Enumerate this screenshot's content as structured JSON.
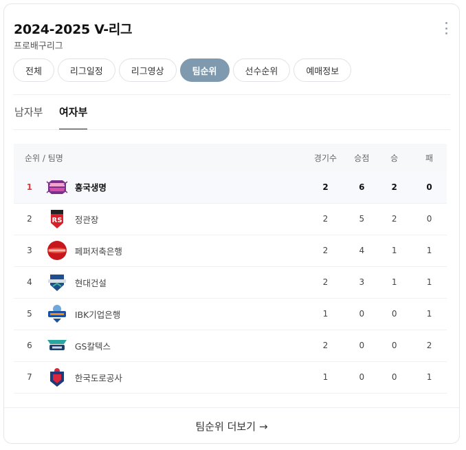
{
  "header": {
    "title": "2024-2025 V-리그",
    "subtitle": "프로배구리그"
  },
  "tabs": [
    {
      "label": "전체",
      "active": false
    },
    {
      "label": "리그일정",
      "active": false
    },
    {
      "label": "리그영상",
      "active": false
    },
    {
      "label": "팀순위",
      "active": true
    },
    {
      "label": "선수순위",
      "active": false
    },
    {
      "label": "예매정보",
      "active": false
    }
  ],
  "subtabs": [
    {
      "label": "남자부",
      "active": false
    },
    {
      "label": "여자부",
      "active": true
    }
  ],
  "table": {
    "headers": {
      "team": "순위 / 팀명",
      "games": "경기수",
      "points": "승점",
      "wins": "승",
      "losses": "패"
    },
    "rows": [
      {
        "rank": "1",
        "team": "흥국생명",
        "games": "2",
        "points": "6",
        "wins": "2",
        "losses": "0",
        "logo": "pinkspiders-logo-icon"
      },
      {
        "rank": "2",
        "team": "정관장",
        "games": "2",
        "points": "5",
        "wins": "2",
        "losses": "0",
        "logo": "redsparks-logo-icon"
      },
      {
        "rank": "3",
        "team": "페퍼저축은행",
        "games": "2",
        "points": "4",
        "wins": "1",
        "losses": "1",
        "logo": "aipeppers-logo-icon"
      },
      {
        "rank": "4",
        "team": "현대건설",
        "games": "2",
        "points": "3",
        "wins": "1",
        "losses": "1",
        "logo": "hillstate-logo-icon"
      },
      {
        "rank": "5",
        "team": "IBK기업은행",
        "games": "1",
        "points": "0",
        "wins": "0",
        "losses": "1",
        "logo": "altos-logo-icon"
      },
      {
        "rank": "6",
        "team": "GS칼텍스",
        "games": "2",
        "points": "0",
        "wins": "0",
        "losses": "2",
        "logo": "kixx-logo-icon"
      },
      {
        "rank": "7",
        "team": "한국도로공사",
        "games": "1",
        "points": "0",
        "wins": "0",
        "losses": "1",
        "logo": "hipass-logo-icon"
      }
    ]
  },
  "footer": {
    "more_label": "팀순위 더보기",
    "arrow": "→"
  },
  "colors": {
    "active_tab": "#7f9aaf",
    "first_rank": "#e03a3a"
  }
}
